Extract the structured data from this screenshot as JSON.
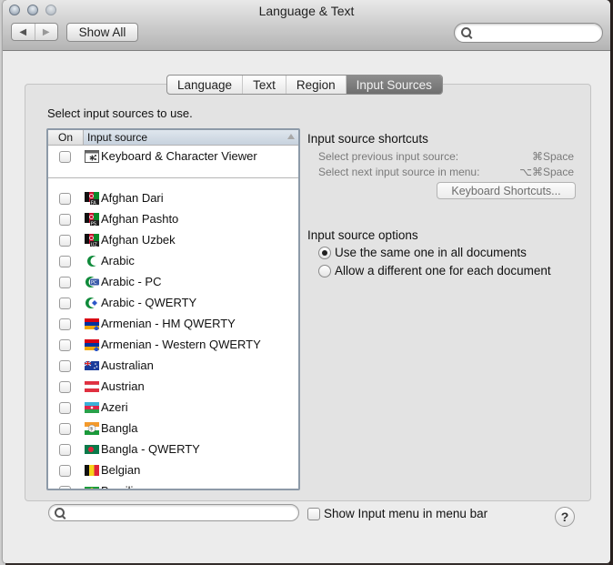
{
  "window": {
    "title": "Language & Text",
    "show_all_label": "Show All",
    "back_icon": "back-arrow-icon",
    "forward_icon": "forward-arrow-icon",
    "search_placeholder": ""
  },
  "tabs": [
    {
      "label": "Language",
      "active": false
    },
    {
      "label": "Text",
      "active": false
    },
    {
      "label": "Region",
      "active": false
    },
    {
      "label": "Input Sources",
      "active": true
    }
  ],
  "main": {
    "instruction": "Select input sources to use.",
    "list": {
      "col_on": "On",
      "col_source": "Input source",
      "pinned": [
        {
          "label": "Keyboard & Character Viewer",
          "checked": false,
          "icon": "keyboard-viewer-icon"
        }
      ],
      "items": [
        {
          "label": "Afghan Dari",
          "checked": false,
          "icon": "flag-afghanistan-icon",
          "code": "FA"
        },
        {
          "label": "Afghan Pashto",
          "checked": false,
          "icon": "flag-afghanistan-icon",
          "code": "PS"
        },
        {
          "label": "Afghan Uzbek",
          "checked": false,
          "icon": "flag-afghanistan-icon",
          "code": "UZ"
        },
        {
          "label": "Arabic",
          "checked": false,
          "icon": "crescent-icon"
        },
        {
          "label": "Arabic - PC",
          "checked": false,
          "icon": "crescent-pc-icon",
          "code": "PC"
        },
        {
          "label": "Arabic - QWERTY",
          "checked": false,
          "icon": "crescent-qwerty-icon"
        },
        {
          "label": "Armenian - HM QWERTY",
          "checked": false,
          "icon": "flag-armenia-icon"
        },
        {
          "label": "Armenian - Western QWERTY",
          "checked": false,
          "icon": "flag-armenia-icon"
        },
        {
          "label": "Australian",
          "checked": false,
          "icon": "flag-australia-icon"
        },
        {
          "label": "Austrian",
          "checked": false,
          "icon": "flag-austria-icon"
        },
        {
          "label": "Azeri",
          "checked": false,
          "icon": "flag-azerbaijan-icon"
        },
        {
          "label": "Bangla",
          "checked": false,
          "icon": "flag-bangla-icon"
        },
        {
          "label": "Bangla - QWERTY",
          "checked": false,
          "icon": "flag-bangladesh-icon"
        },
        {
          "label": "Belgian",
          "checked": false,
          "icon": "flag-belgium-icon"
        },
        {
          "label": "Brazilian",
          "checked": false,
          "icon": "flag-brazil-icon"
        }
      ]
    },
    "search_placeholder": ""
  },
  "shortcuts": {
    "heading": "Input source shortcuts",
    "prev_label": "Select previous input source:",
    "prev_keys": "⌘Space",
    "next_label": "Select next input source in menu:",
    "next_keys": "⌥⌘Space",
    "button_label": "Keyboard Shortcuts..."
  },
  "options": {
    "heading": "Input source options",
    "choices": [
      {
        "label": "Use the same one in all documents",
        "selected": true
      },
      {
        "label": "Allow a different one for each document",
        "selected": false
      }
    ]
  },
  "footer": {
    "show_menu_label": "Show Input menu in menu bar",
    "show_menu_checked": false,
    "help_label": "?"
  },
  "colors": {
    "active_tab": "#7c7c7c",
    "list_header_selected": "#cfd9e4",
    "list_border": "#8d9aa8"
  }
}
